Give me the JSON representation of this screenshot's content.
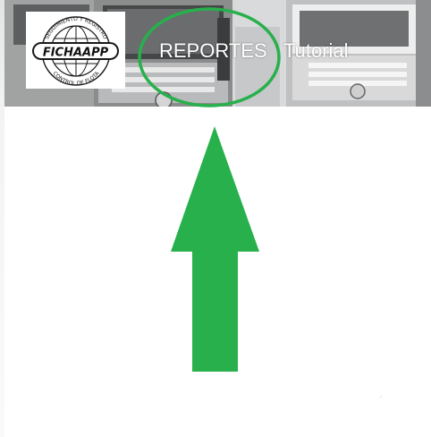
{
  "logo": {
    "brand_text": "FICHAAPP",
    "ring_text_top": "SEGUIMIENTO Y REGISTRO",
    "ring_text_bottom": "CONTROL DE FLOTA"
  },
  "nav": {
    "items": [
      {
        "label": "REPORTES"
      },
      {
        "label": "Tutorial"
      }
    ]
  },
  "annotation": {
    "color": "#27b04b"
  },
  "header_image": {
    "description_icon": "trucks-photo"
  }
}
